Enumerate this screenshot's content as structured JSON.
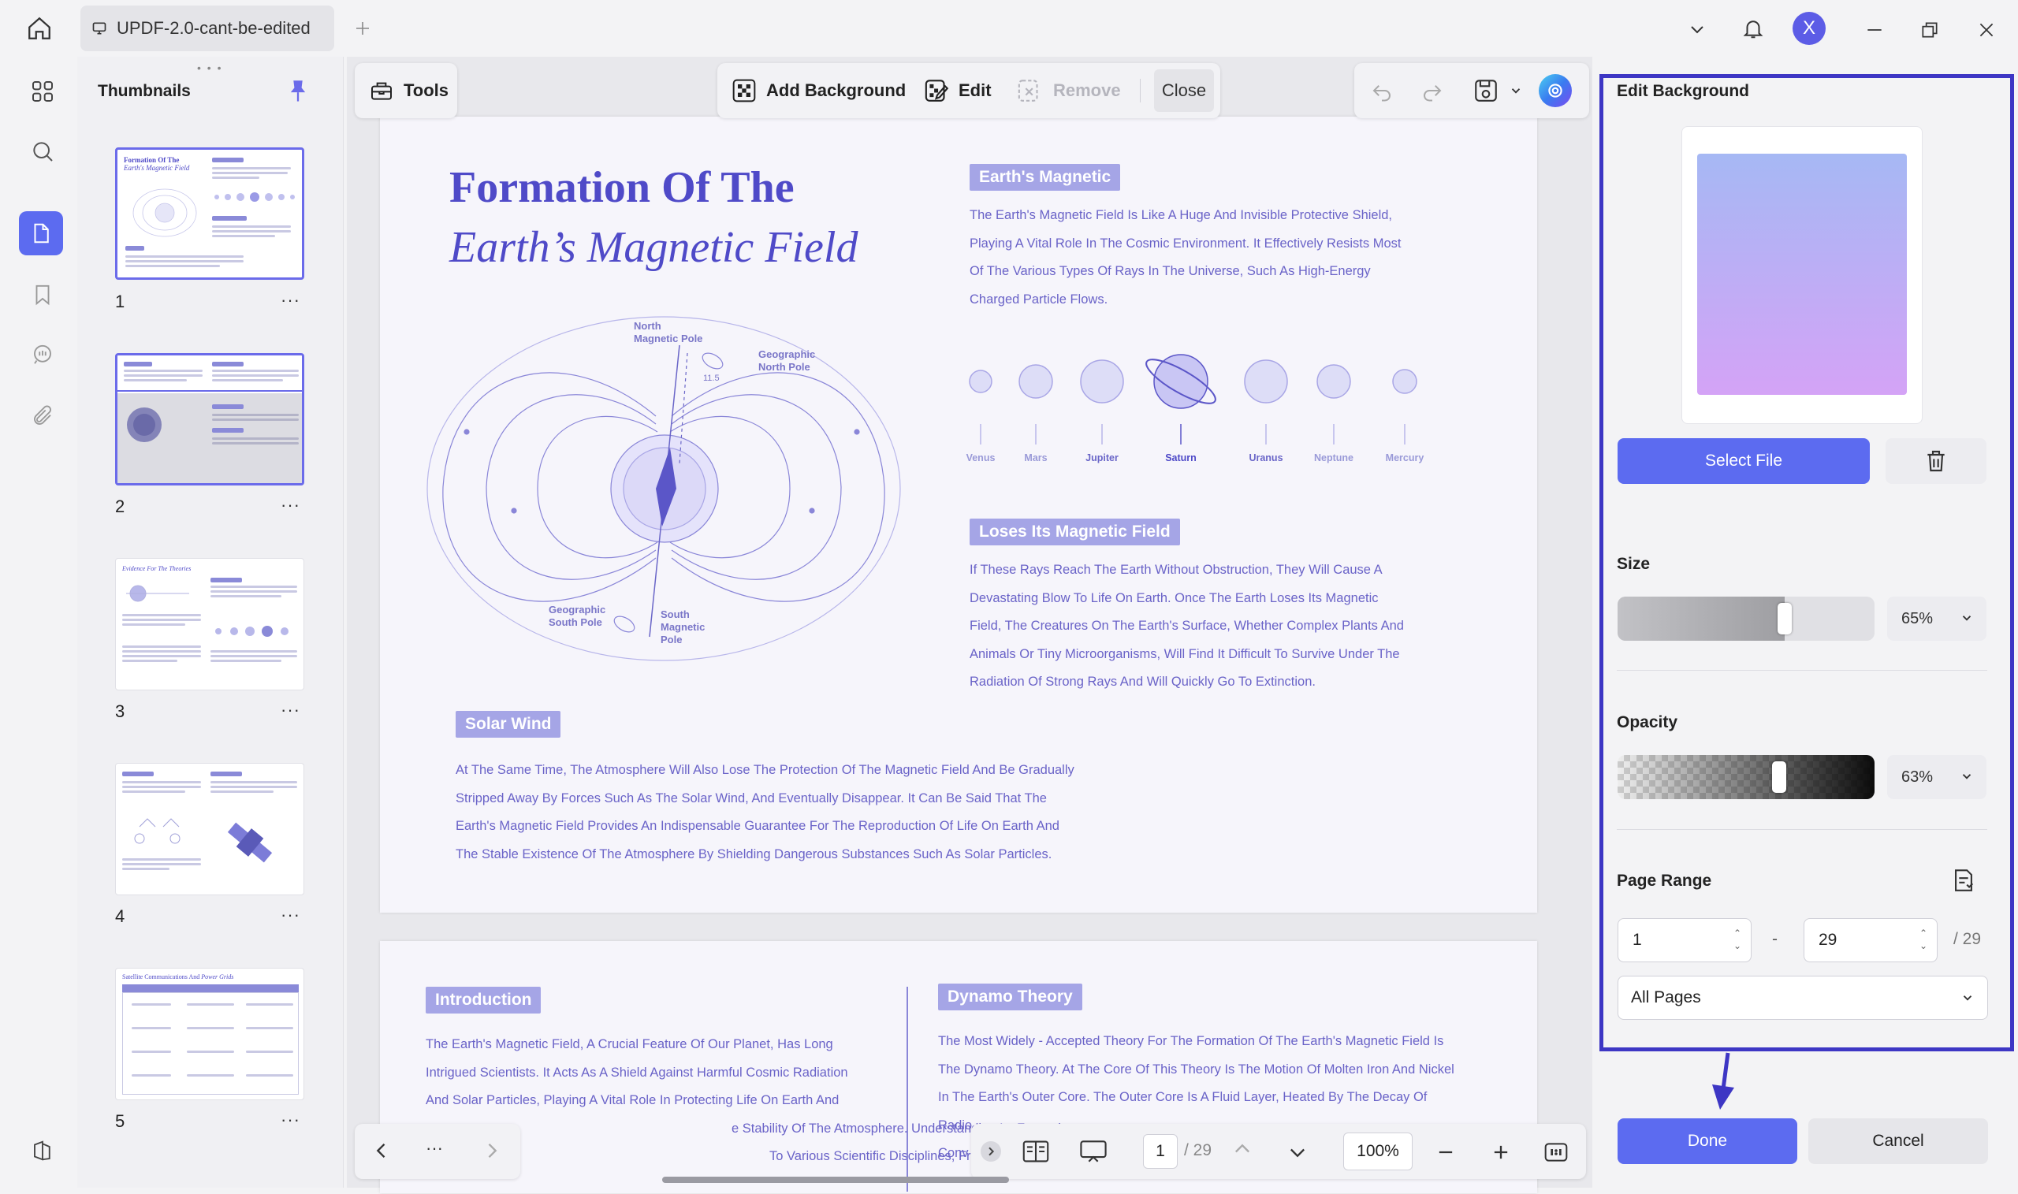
{
  "window": {
    "tab_title": "UPDF-2.0-cant-be-edited",
    "avatar_letter": "X"
  },
  "thumbnails": {
    "title": "Thumbnails",
    "pages": [
      {
        "number": "1",
        "selected": true
      },
      {
        "number": "2",
        "selected": false
      },
      {
        "number": "3",
        "selected": false
      },
      {
        "number": "4",
        "selected": false
      },
      {
        "number": "5",
        "selected": false
      }
    ],
    "more_label": "···"
  },
  "toolbar": {
    "tools_label": "Tools",
    "add_background_label": "Add Background",
    "edit_label": "Edit",
    "remove_label": "Remove",
    "close_label": "Close"
  },
  "document": {
    "title_line1": "Formation Of The",
    "title_line2": "Earth’s Magnetic Field",
    "diagram_labels": {
      "north_magnetic_pole": "North\nMagnetic Pole",
      "geographic_north_pole": "Geographic\nNorth Pole",
      "geographic_south_pole": "Geographic\nSouth Pole",
      "south_magnetic_pole": "South\nMagnetic\nPole",
      "angle": "11.5"
    },
    "earths_magnetic": {
      "heading": "Earth's Magnetic",
      "lines": [
        "The Earth's Magnetic Field Is Like A Huge And Invisible Protective Shield,",
        "Playing A Vital Role In The Cosmic Environment. It Effectively Resists Most",
        "Of The Various Types Of Rays In The Universe, Such As High-Energy",
        "Charged Particle Flows."
      ]
    },
    "planets": [
      "Venus",
      "Mars",
      "Jupiter",
      "Saturn",
      "Uranus",
      "Neptune",
      "Mercury"
    ],
    "loses_field": {
      "heading": "Loses Its Magnetic Field",
      "lines": [
        "If These Rays Reach The Earth Without Obstruction, They Will Cause A",
        "Devastating Blow To Life On Earth. Once The Earth Loses Its Magnetic",
        "Field, The Creatures On The Earth's Surface, Whether Complex Plants And",
        "Animals Or Tiny Microorganisms, Will Find It Difficult To Survive Under The",
        "Radiation Of Strong Rays And Will Quickly Go To Extinction."
      ]
    },
    "solar_wind": {
      "heading": "Solar Wind",
      "lines": [
        "At The Same Time, The Atmosphere Will Also Lose The Protection Of The Magnetic Field And Be Gradually",
        "Stripped Away By Forces Such As The Solar Wind, And Eventually Disappear. It Can Be Said That The",
        "Earth's Magnetic Field Provides An Indispensable Guarantee For The Reproduction Of Life On Earth And",
        "The Stable Existence Of The Atmosphere By Shielding Dangerous Substances Such As Solar Particles."
      ]
    },
    "introduction": {
      "heading": "Introduction",
      "lines": [
        "The Earth's Magnetic Field, A Crucial Feature Of Our Planet, Has Long",
        "Intrigued Scientists. It Acts As A Shield Against Harmful Cosmic Radiation",
        "And Solar Particles, Playing A Vital Role In Protecting Life On Earth And",
        "e Stability Of The Atmosphere. Understanding Its Formation",
        "To Various Scientific Disciplines, From Geophysics To"
      ]
    },
    "dynamo": {
      "heading": "Dynamo Theory",
      "lines": [
        "The Most Widely - Accepted Theory For The Formation Of The Earth's Magnetic Field Is",
        "The Dynamo Theory. At The Core Of This Theory Is The Motion Of Molten Iron And Nickel",
        "In The Earth's Outer Core. The Outer Core Is A Fluid Layer, Heated By The Decay Of",
        "Radio",
        "Conv"
      ]
    }
  },
  "bottom_nav": {
    "more": "···",
    "current_page": "1",
    "total_pages": "/ 29",
    "zoom": "100%"
  },
  "edit_background": {
    "title": "Edit Background",
    "preview_colors": {
      "top": "#a6b8f4",
      "bottom": "#d4a3f6"
    },
    "select_file_label": "Select File",
    "size_label": "Size",
    "size_value": "65%",
    "size_fraction": 0.65,
    "opacity_label": "Opacity",
    "opacity_value": "63%",
    "opacity_fraction": 0.63,
    "page_range_label": "Page Range",
    "range_start": "1",
    "range_sep": "-",
    "range_end": "29",
    "range_total": "/ 29",
    "pages_option": "All Pages",
    "done_label": "Done",
    "cancel_label": "Cancel"
  },
  "colors": {
    "accent": "#5c6bf0",
    "highlight_frame": "#3d36c4",
    "doc_text": "#6a63c8",
    "doc_title": "#4f4ac8"
  }
}
